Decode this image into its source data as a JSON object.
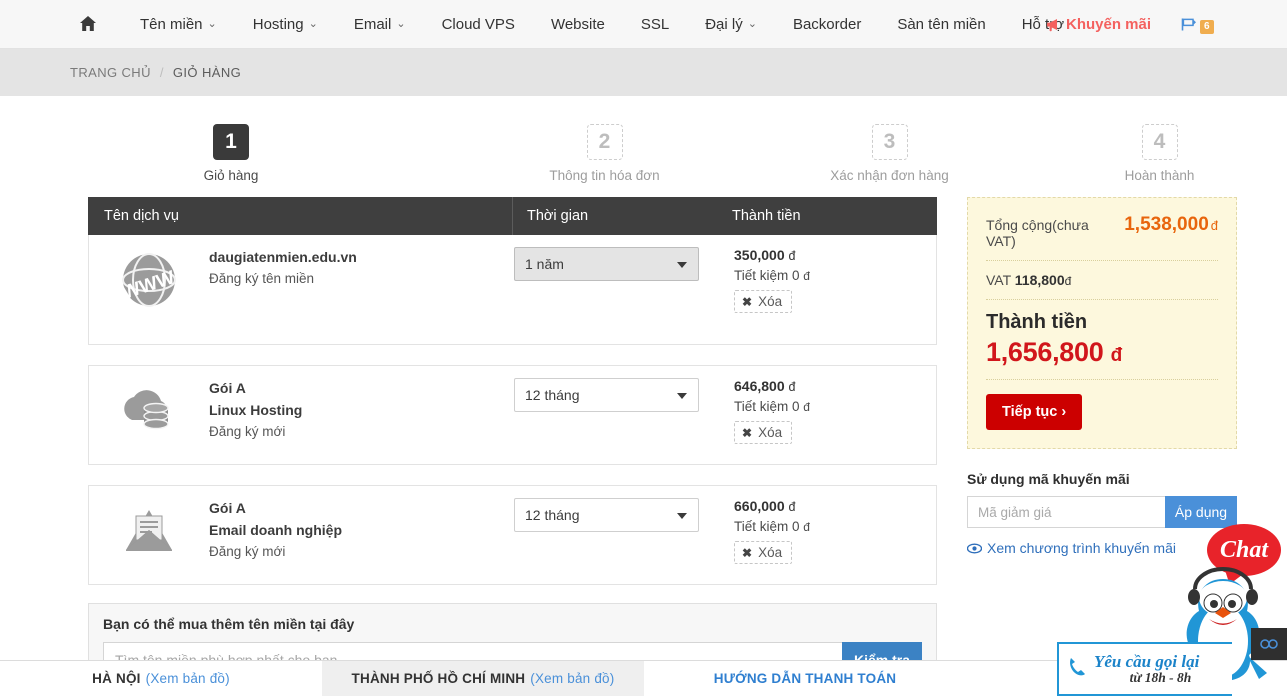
{
  "nav": {
    "home_icon": "home-icon",
    "items": [
      {
        "label": "Tên miền",
        "caret": true
      },
      {
        "label": "Hosting",
        "caret": true
      },
      {
        "label": "Email",
        "caret": true
      },
      {
        "label": "Cloud VPS",
        "caret": false
      },
      {
        "label": "Website",
        "caret": false
      },
      {
        "label": "SSL",
        "caret": false
      },
      {
        "label": "Đại lý",
        "caret": true
      },
      {
        "label": "Backorder",
        "caret": false
      },
      {
        "label": "Sàn tên miền",
        "caret": false
      },
      {
        "label": "Hỗ trợ",
        "caret": false
      }
    ],
    "promo_label": "Khuyến mãi",
    "promo_icon": "megaphone-icon",
    "flag_icon": "flag-icon",
    "flag_badge": "6",
    "promo_color": "#f4615f",
    "badge_color": "#f0ad4e"
  },
  "breadcrumb": {
    "home": "TRANG CHỦ",
    "separator": "/",
    "current": "GIỎ HÀNG"
  },
  "steps": [
    {
      "num": "1",
      "label": "Giỏ hàng",
      "state": "active"
    },
    {
      "num": "2",
      "label": "Thông tin hóa đơn",
      "state": "idle"
    },
    {
      "num": "3",
      "label": "Xác nhận đơn hàng",
      "state": "idle"
    },
    {
      "num": "4",
      "label": "Hoàn thành",
      "state": "idle"
    }
  ],
  "cart": {
    "headers": {
      "name": "Tên dịch vụ",
      "time": "Thời gian",
      "total": "Thành tiền"
    },
    "rows": [
      {
        "icon": "globe-www-icon",
        "title": "daugiatenmien.edu.vn",
        "subtitle": "",
        "note": "Đăng ký tên miền",
        "period": "1 năm",
        "period_disabled": true,
        "price": "350,000",
        "currency": "đ",
        "saving": "Tiết kiệm 0",
        "saving_currency": "đ",
        "delete_label": "Xóa"
      },
      {
        "icon": "hosting-server-icon",
        "title": "Gói A",
        "subtitle": "Linux Hosting",
        "note": "Đăng ký mới",
        "period": "12 tháng",
        "period_disabled": false,
        "price": "646,800",
        "currency": "đ",
        "saving": "Tiết kiệm 0",
        "saving_currency": "đ",
        "delete_label": "Xóa"
      },
      {
        "icon": "envelope-icon",
        "title": "Gói A",
        "subtitle": "Email doanh nghiệp",
        "note": "Đăng ký mới",
        "period": "12 tháng",
        "period_disabled": false,
        "price": "660,000",
        "currency": "đ",
        "saving": "Tiết kiệm 0",
        "saving_currency": "đ",
        "delete_label": "Xóa"
      }
    ]
  },
  "domain_search": {
    "title": "Bạn có thể mua thêm tên miền tại đây",
    "placeholder": "Tìm tên miền phù hợp nhất cho bạn",
    "value": "",
    "button": "Kiểm tra",
    "button_color": "#3b82c4"
  },
  "summary": {
    "subtotal_label": "Tổng cộng(chưa VAT)",
    "subtotal_value": "1,538,000",
    "subtotal_currency": "đ",
    "subtotal_color": "#e8650d",
    "vat_label": "VAT",
    "vat_value": "118,800",
    "vat_currency": "đ",
    "total_label": "Thành tiền",
    "total_value": "1,656,800",
    "total_currency": "đ",
    "total_color": "#d1161b",
    "continue_label": "Tiếp tục ›",
    "continue_color": "#cc0000"
  },
  "promo": {
    "title": "Sử dụng mã khuyến mãi",
    "placeholder": "Mã giảm giá",
    "value": "",
    "apply_label": "Áp dụng",
    "apply_color": "#4a90d9",
    "link_icon": "eye-icon",
    "link_label": "Xem chương trình khuyến mãi",
    "link_color": "#2f6fbb"
  },
  "tabs": [
    {
      "label": "HÀ NỘI",
      "sub": "(Xem bản đồ)",
      "active": false
    },
    {
      "label": "THÀNH PHỐ HỒ CHÍ MINH",
      "sub": "(Xem bản đồ)",
      "active": true
    },
    {
      "label": "HƯỚNG DẪN THANH TOÁN",
      "sub": "",
      "active": false
    }
  ],
  "chat": {
    "bubble_label": "Chat",
    "bubble_color": "#e8232a",
    "callback_line1": "Yêu cầu gọi lại",
    "callback_line2": "từ 18h - 8h",
    "phone_icon": "phone-icon",
    "penguin_icon": "penguin-mascot-icon",
    "share_icon": "share-icon"
  }
}
